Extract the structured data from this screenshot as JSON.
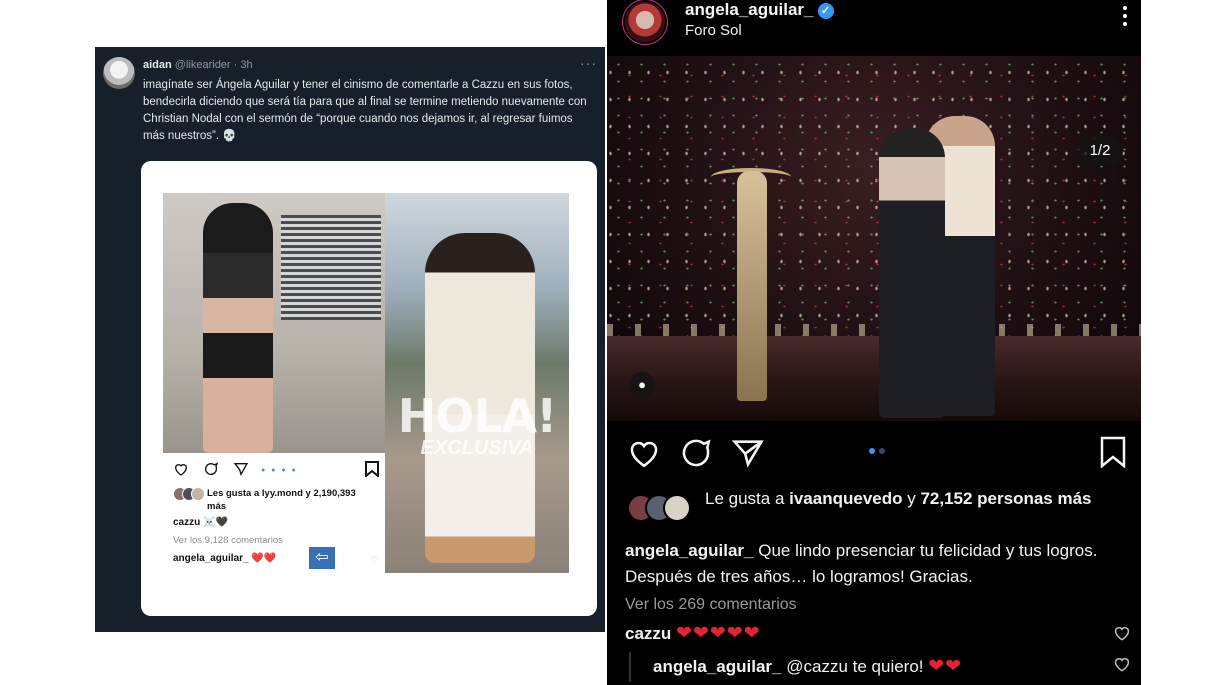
{
  "tweet": {
    "name": "aidan",
    "handle": "@likearider",
    "time": "· 3h",
    "more": "···",
    "text": "imagínate ser Ángela Aguilar y tener el cinismo de comentarle a Cazzu en sus fotos, bendecirla diciendo que será tía para que al final se termine metiendo nuevamente con Christian Nodal con el sermón de “porque cuando nos dejamos ir, al regresar fuimos más nuestros”. 💀",
    "embedded_post": {
      "watermark_big": "HOLA!",
      "watermark_small": "EXCLUSIVA",
      "likes": "Les gusta a lyy.mond y 2,190,393 más",
      "comment1": "cazzu ☠️🖤",
      "view_all": "Ver los 9,128 comentarios",
      "comment2": "angela_aguilar_ ❤️❤️",
      "arrow": "⇦"
    }
  },
  "instagram": {
    "username": "angela_aguilar_",
    "verified_mark": "✓",
    "location": "Foro Sol",
    "counter": "1/2",
    "tag_icon": "●",
    "likes_prefix": "Le gusta a ",
    "likes_user": "ivaanquevedo",
    "likes_mid": " y ",
    "likes_rest": "72,152 personas más",
    "caption_user": "angela_aguilar_",
    "caption_text": " Que lindo presenciar tu felicidad y tus logros. Después de tres años… lo logramos! Gracias.",
    "view_all": "Ver los 269 comentarios",
    "comment1_user": "cazzu",
    "comment1_text": "❤❤❤❤❤",
    "comment2_user": "angela_aguilar_",
    "comment2_text": " @cazzu te quiero! ",
    "comment2_hearts": "❤❤"
  },
  "colors": {
    "twitter_bg": "#15202b",
    "instagram_bg": "#000000",
    "heart_red": "#e4242e",
    "verified_blue": "#3897f0"
  }
}
